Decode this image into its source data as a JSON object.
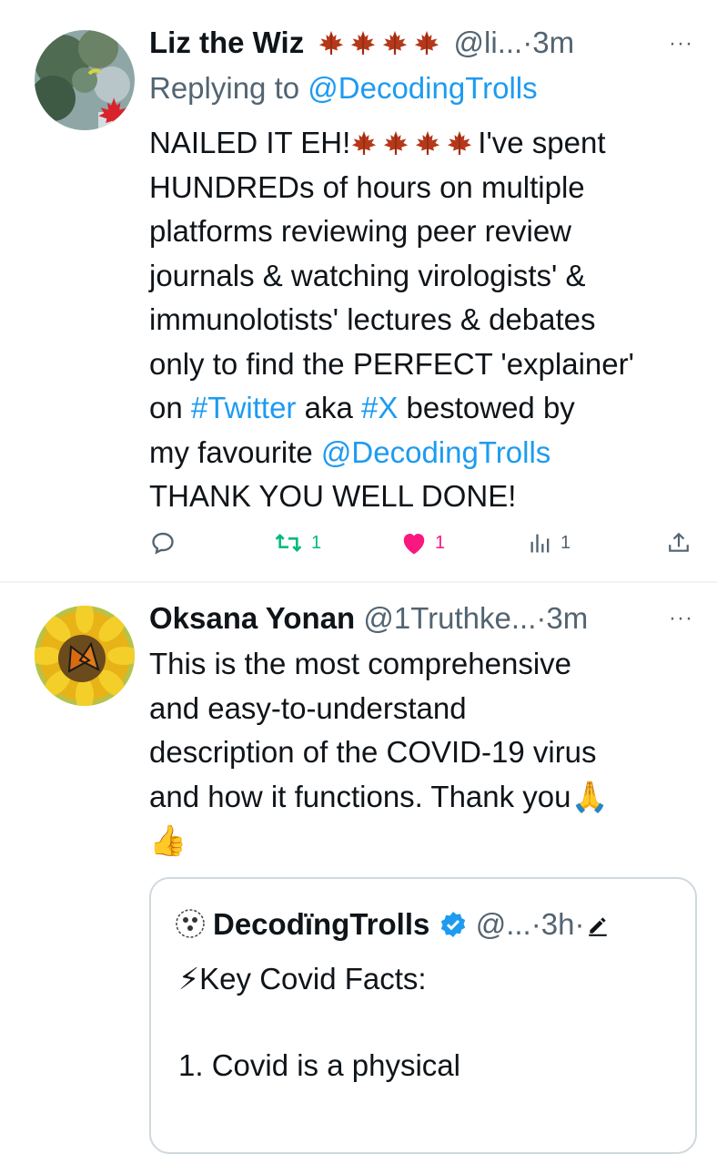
{
  "tweet1": {
    "display_name": "Liz the Wiz",
    "handle": "@li...",
    "dot": "·",
    "time": "3m",
    "more": "···",
    "replying_prefix": "Replying to ",
    "replying_handle": "@DecodingTrolls",
    "lines": {
      "l1a": "NAILED IT EH!",
      "l1b": "I've spent",
      "l2": "HUNDREDs of hours on multiple",
      "l3": "platforms reviewing peer review",
      "l4": "journals & watching virologists' &",
      "l5": "immunolotists' lectures & debates",
      "l6": "only to find the PERFECT 'explainer'",
      "l7a": "on ",
      "l7b": "#Twitter",
      "l7c": " aka ",
      "l7d": "#X",
      "l7e": " bestowed by",
      "l8a": "my favourite ",
      "l8b": "@DecodingTrolls",
      "l9": "THANK YOU WELL DONE!"
    },
    "retweets": "1",
    "likes": "1",
    "views": "1"
  },
  "tweet2": {
    "display_name": "Oksana Yonan",
    "handle": "@1Truthke...",
    "dot": "·",
    "time": "3m",
    "more": "···",
    "lines": {
      "l1": "This is the most comprehensive",
      "l2": "and easy-to-understand",
      "l3": "description of the COVID-19 virus",
      "l4": "and how it functions. Thank you🙏",
      "l5": "👍"
    },
    "quote": {
      "display_name": "DecodïngTrolls",
      "handle": "@...",
      "dot": "·",
      "time": "3h",
      "dot2": "·",
      "line1": "⚡Key Covid Facts:",
      "line2": "1. Covid is a physical"
    }
  },
  "colors": {
    "accent": "#1d9bf0",
    "retweet": "#00ba7c",
    "like": "#f91880",
    "secondary": "#536471",
    "maple": "#b5381a"
  },
  "icons": [
    "maple-leaf-icon",
    "reply-icon",
    "retweet-icon",
    "heart-icon",
    "views-icon",
    "share-icon",
    "verified-icon",
    "edit-icon",
    "more-icon"
  ]
}
